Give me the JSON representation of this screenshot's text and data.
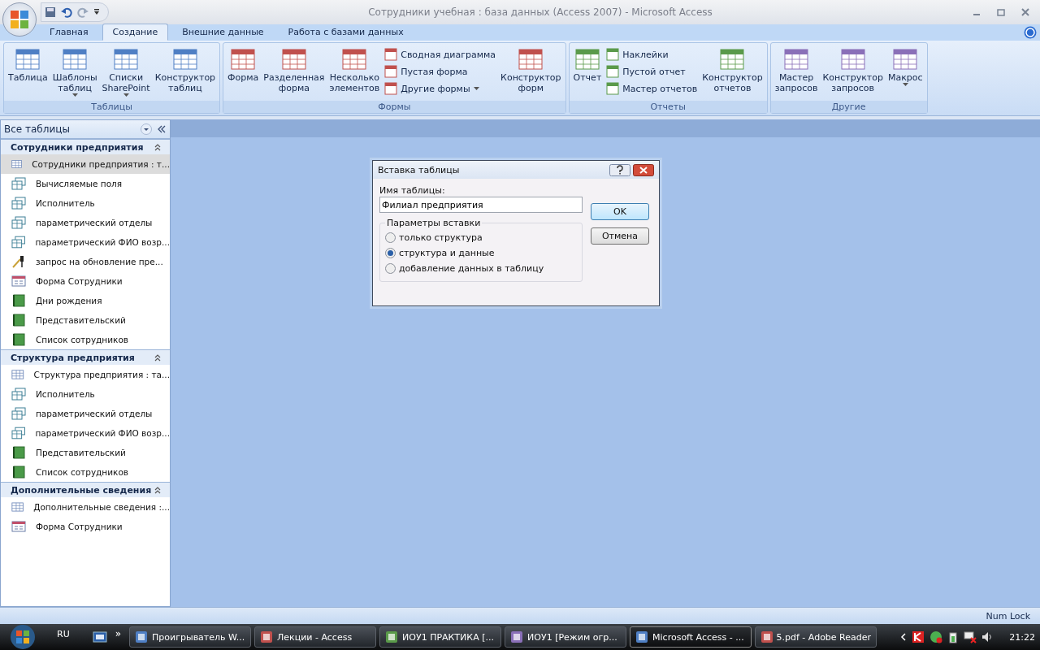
{
  "window": {
    "title": "Сотрудники учебная : база данных (Access 2007)  -  Microsoft Access"
  },
  "tabs": [
    {
      "label": "Главная",
      "selected": false
    },
    {
      "label": "Создание",
      "selected": true
    },
    {
      "label": "Внешние данные",
      "selected": false
    },
    {
      "label": "Работа с базами данных",
      "selected": false
    }
  ],
  "ribbon": {
    "groups": [
      {
        "label": "Таблицы",
        "items": [
          {
            "kind": "large",
            "lines": [
              "Таблица"
            ],
            "has_menu": false
          },
          {
            "kind": "large",
            "lines": [
              "Шаблоны",
              "таблиц"
            ],
            "has_menu": true
          },
          {
            "kind": "large",
            "lines": [
              "Списки",
              "SharePoint"
            ],
            "has_menu": true
          },
          {
            "kind": "large",
            "lines": [
              "Конструктор",
              "таблиц"
            ],
            "has_menu": false
          }
        ]
      },
      {
        "label": "Формы",
        "items": [
          {
            "kind": "large",
            "lines": [
              "Форма"
            ],
            "has_menu": false
          },
          {
            "kind": "large",
            "lines": [
              "Разделенная",
              "форма"
            ],
            "has_menu": false
          },
          {
            "kind": "large",
            "lines": [
              "Несколько",
              "элементов"
            ],
            "has_menu": false
          },
          {
            "kind": "small",
            "lines": [
              "Сводная диаграмма"
            ],
            "has_menu": false
          },
          {
            "kind": "small",
            "lines": [
              "Пустая форма"
            ],
            "has_menu": false
          },
          {
            "kind": "small",
            "lines": [
              "Другие формы"
            ],
            "has_menu": true
          },
          {
            "kind": "large",
            "lines": [
              "Конструктор",
              "форм"
            ],
            "has_menu": false
          }
        ]
      },
      {
        "label": "Отчеты",
        "items": [
          {
            "kind": "large",
            "lines": [
              "Отчет"
            ],
            "has_menu": false
          },
          {
            "kind": "small",
            "lines": [
              "Наклейки"
            ],
            "has_menu": false
          },
          {
            "kind": "small",
            "lines": [
              "Пустой отчет"
            ],
            "has_menu": false
          },
          {
            "kind": "small",
            "lines": [
              "Мастер отчетов"
            ],
            "has_menu": false
          },
          {
            "kind": "large",
            "lines": [
              "Конструктор",
              "отчетов"
            ],
            "has_menu": false
          }
        ]
      },
      {
        "label": "Другие",
        "items": [
          {
            "kind": "large",
            "lines": [
              "Мастер",
              "запросов"
            ],
            "has_menu": false
          },
          {
            "kind": "large",
            "lines": [
              "Конструктор",
              "запросов"
            ],
            "has_menu": false
          },
          {
            "kind": "large",
            "lines": [
              "Макрос"
            ],
            "has_menu": true
          }
        ]
      }
    ]
  },
  "nav": {
    "title": "Все таблицы",
    "groups": [
      {
        "title": "Сотрудники предприятия",
        "items": [
          {
            "kind": "table",
            "label": "Сотрудники предприятия : т...",
            "selected": true
          },
          {
            "kind": "query",
            "label": "Вычисляемые поля",
            "selected": false
          },
          {
            "kind": "query",
            "label": "Исполнитель",
            "selected": false
          },
          {
            "kind": "query",
            "label": "параметрический отделы",
            "selected": false
          },
          {
            "kind": "query",
            "label": "параметрический ФИО возр...",
            "selected": false
          },
          {
            "kind": "update",
            "label": "запрос на обновление пре...",
            "selected": false
          },
          {
            "kind": "form",
            "label": "Форма Сотрудники",
            "selected": false
          },
          {
            "kind": "report",
            "label": "Дни рождения",
            "selected": false
          },
          {
            "kind": "report",
            "label": "Представительский",
            "selected": false
          },
          {
            "kind": "report",
            "label": "Список сотрудников",
            "selected": false
          }
        ]
      },
      {
        "title": "Структура предприятия",
        "items": [
          {
            "kind": "table",
            "label": "Структура предприятия : та...",
            "selected": false
          },
          {
            "kind": "query",
            "label": "Исполнитель",
            "selected": false
          },
          {
            "kind": "query",
            "label": "параметрический отделы",
            "selected": false
          },
          {
            "kind": "query",
            "label": "параметрический ФИО возр...",
            "selected": false
          },
          {
            "kind": "report",
            "label": "Представительский",
            "selected": false
          },
          {
            "kind": "report",
            "label": "Список сотрудников",
            "selected": false
          }
        ]
      },
      {
        "title": "Дополнительные сведения",
        "items": [
          {
            "kind": "table",
            "label": "Дополнительные сведения :...",
            "selected": false
          },
          {
            "kind": "form",
            "label": "Форма Сотрудники",
            "selected": false
          }
        ]
      }
    ]
  },
  "dialog": {
    "title": "Вставка таблицы",
    "name_label": "Имя таблицы:",
    "name_value": "Филиал предприятия",
    "frame_label": "Параметры вставки",
    "options": [
      {
        "label": "только структура",
        "selected": false
      },
      {
        "label": "структура и данные",
        "selected": true
      },
      {
        "label": "добавление данных в таблицу",
        "selected": false
      }
    ],
    "buttons": [
      {
        "label": "OK",
        "default": true
      },
      {
        "label": "Отмена",
        "default": false
      }
    ]
  },
  "status_bar": {
    "text": "Num Lock"
  },
  "taskbar": {
    "language": "RU",
    "overflow": "»",
    "tasks": [
      {
        "label": "Проигрыватель W...",
        "active": false
      },
      {
        "label": "Лекции - Access",
        "active": false
      },
      {
        "label": "ИОУ1 ПРАКТИКА [...",
        "active": false
      },
      {
        "label": "ИОУ1 [Режим огр...",
        "active": false
      },
      {
        "label": "Microsoft Access - ...",
        "active": true
      },
      {
        "label": "5.pdf - Adobe Reader",
        "active": false
      }
    ],
    "clock": "21:22"
  }
}
